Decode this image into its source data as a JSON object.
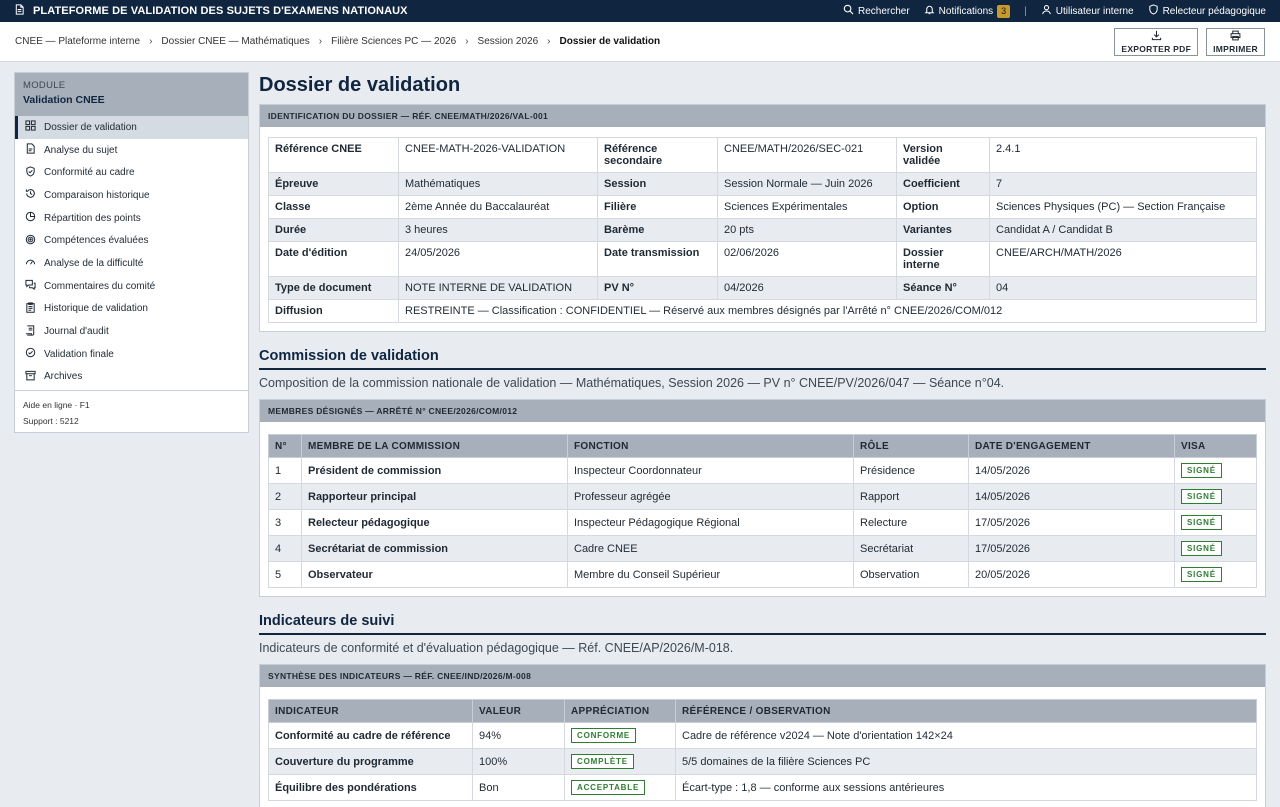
{
  "topbar": {
    "title": "PLATEFORME DE VALIDATION DES SUJETS D'EXAMENS NATIONAUX",
    "search": "Rechercher",
    "notifications": "Notifications",
    "notif_count": "3",
    "user": "Utilisateur interne",
    "role": "Relecteur pédagogique"
  },
  "breadcrumb": [
    "CNEE — Plateforme interne",
    "Dossier CNEE — Mathématiques",
    "Filière Sciences PC — 2026",
    "Session 2026",
    "Dossier de validation"
  ],
  "actions": {
    "export": "EXPORTER PDF",
    "print": "IMPRIMER"
  },
  "sidebar": {
    "module_label": "MODULE",
    "module_name": "Validation CNEE",
    "items": [
      {
        "label": "Dossier de validation",
        "icon": "grid-icon"
      },
      {
        "label": "Analyse du sujet",
        "icon": "document-icon"
      },
      {
        "label": "Conformité au cadre",
        "icon": "shield-check-icon"
      },
      {
        "label": "Comparaison historique",
        "icon": "history-icon"
      },
      {
        "label": "Répartition des points",
        "icon": "pie-icon"
      },
      {
        "label": "Compétences évaluées",
        "icon": "target-icon"
      },
      {
        "label": "Analyse de la difficulté",
        "icon": "gauge-icon"
      },
      {
        "label": "Commentaires du comité",
        "icon": "comments-icon"
      },
      {
        "label": "Historique de validation",
        "icon": "clipboard-icon"
      },
      {
        "label": "Journal d'audit",
        "icon": "scroll-icon"
      },
      {
        "label": "Validation finale",
        "icon": "check-circle-icon"
      },
      {
        "label": "Archives",
        "icon": "archive-icon"
      }
    ],
    "help": "Aide en ligne · F1",
    "support": "Support : 5212"
  },
  "main": {
    "title": "Dossier de validation",
    "ident_panel": "IDENTIFICATION DU DOSSIER — RÉF. CNEE/MATH/2026/VAL-001",
    "ident": [
      [
        "Référence CNEE",
        "CNEE-MATH-2026-VALIDATION",
        "Référence secondaire",
        "CNEE/MATH/2026/SEC-021",
        "Version validée",
        "2.4.1"
      ],
      [
        "Épreuve",
        "Mathématiques",
        "Session",
        "Session Normale — Juin 2026",
        "Coefficient",
        "7"
      ],
      [
        "Classe",
        "2ème Année du Baccalauréat",
        "Filière",
        "Sciences Expérimentales",
        "Option",
        "Sciences Physiques (PC) — Section Française"
      ],
      [
        "Durée",
        "3 heures",
        "Barème",
        "20 pts",
        "Variantes",
        "Candidat A / Candidat B"
      ],
      [
        "Date d'édition",
        "24/05/2026",
        "Date transmission",
        "02/06/2026",
        "Dossier interne",
        "CNEE/ARCH/MATH/2026"
      ],
      [
        "Type de document",
        "NOTE INTERNE DE VALIDATION",
        "PV N°",
        "04/2026",
        "Séance N°",
        "04"
      ]
    ],
    "diffusion_label": "Diffusion",
    "diffusion_value": "RESTREINTE — Classification : CONFIDENTIEL — Réservé aux membres désignés par l'Arrêté n° CNEE/2026/COM/012",
    "commission": {
      "title": "Commission de validation",
      "subtitle": "Composition de la commission nationale de validation — Mathématiques, Session 2026 — PV n° CNEE/PV/2026/047 — Séance n°04.",
      "panel": "MEMBRES DÉSIGNÉS — ARRÊTÉ N° CNEE/2026/COM/012",
      "headers": [
        "N°",
        "MEMBRE DE LA COMMISSION",
        "FONCTION",
        "RÔLE",
        "DATE D'ENGAGEMENT",
        "VISA"
      ],
      "rows": [
        [
          "1",
          "Président de commission",
          "Inspecteur Coordonnateur",
          "Présidence",
          "14/05/2026",
          "SIGNÉ"
        ],
        [
          "2",
          "Rapporteur principal",
          "Professeur agrégée",
          "Rapport",
          "14/05/2026",
          "SIGNÉ"
        ],
        [
          "3",
          "Relecteur pédagogique",
          "Inspecteur Pédagogique Régional",
          "Relecture",
          "17/05/2026",
          "SIGNÉ"
        ],
        [
          "4",
          "Secrétariat de commission",
          "Cadre CNEE",
          "Secrétariat",
          "17/05/2026",
          "SIGNÉ"
        ],
        [
          "5",
          "Observateur",
          "Membre du Conseil Supérieur",
          "Observation",
          "20/05/2026",
          "SIGNÉ"
        ]
      ]
    },
    "indicators": {
      "title": "Indicateurs de suivi",
      "subtitle": "Indicateurs de conformité et d'évaluation pédagogique — Réf. CNEE/AP/2026/M-018.",
      "panel": "SYNTHÈSE DES INDICATEURS — RÉF. CNEE/IND/2026/M-008",
      "headers": [
        "INDICATEUR",
        "VALEUR",
        "APPRÉCIATION",
        "RÉFÉRENCE / OBSERVATION"
      ],
      "rows": [
        [
          "Conformité au cadre de référence",
          "94%",
          "CONFORME",
          "Cadre de référence v2024 — Note d'orientation 142×24"
        ],
        [
          "Couverture du programme",
          "100%",
          "COMPLÈTE",
          "5/5 domaines de la filière Sciences PC"
        ],
        [
          "Équilibre des pondérations",
          "Bon",
          "ACCEPTABLE",
          "Écart-type : 1,8 — conforme aux sessions antérieures"
        ]
      ]
    }
  },
  "colors": {
    "navy": "#0f2540",
    "header_gray": "#a6afba",
    "stamp_green": "#2e7d32",
    "badge": "#c89a2c"
  }
}
